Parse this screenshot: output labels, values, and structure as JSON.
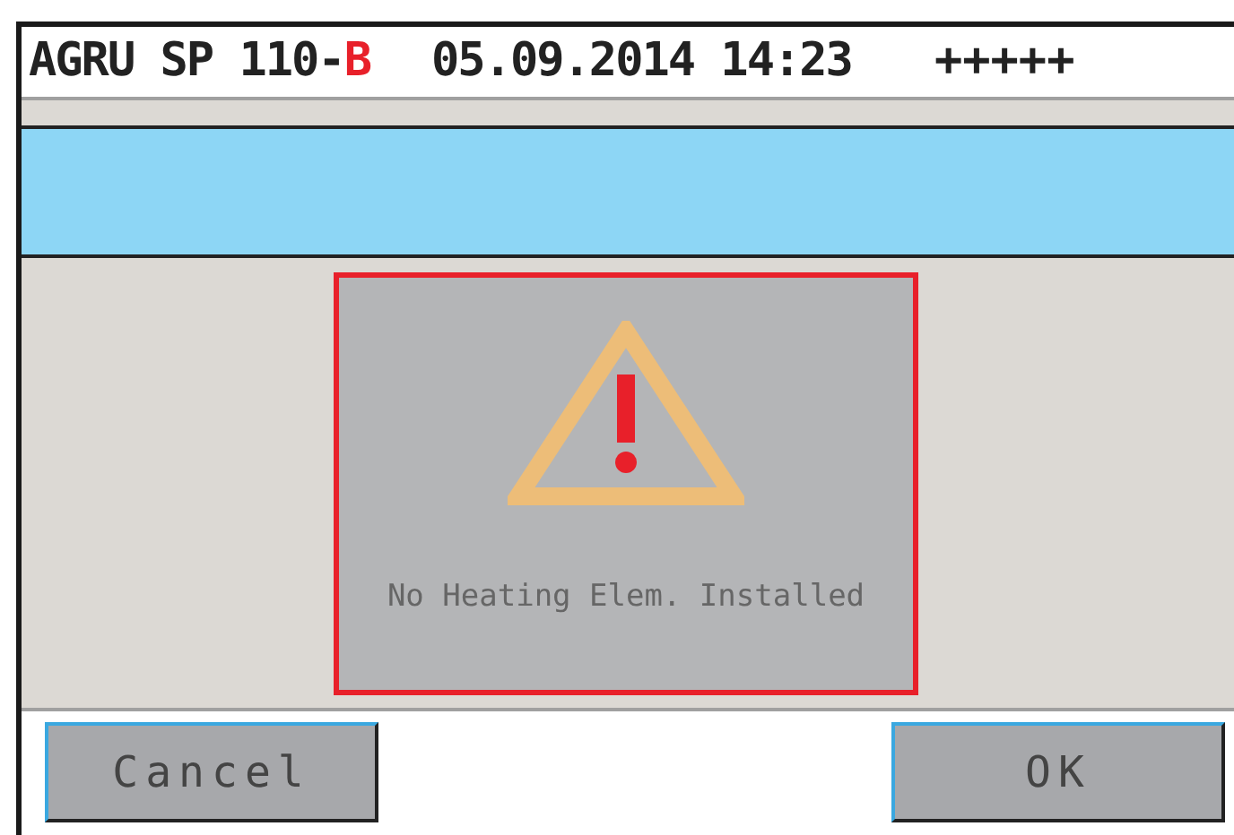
{
  "header": {
    "title": "AGRU SP 110-",
    "variant": "B",
    "datetime": "05.09.2014 14:23",
    "signal": "+++++"
  },
  "dialog": {
    "message": "No Heating Elem. Installed"
  },
  "buttons": [
    {
      "label": "Cancel"
    },
    {
      "label": "OK"
    }
  ]
}
